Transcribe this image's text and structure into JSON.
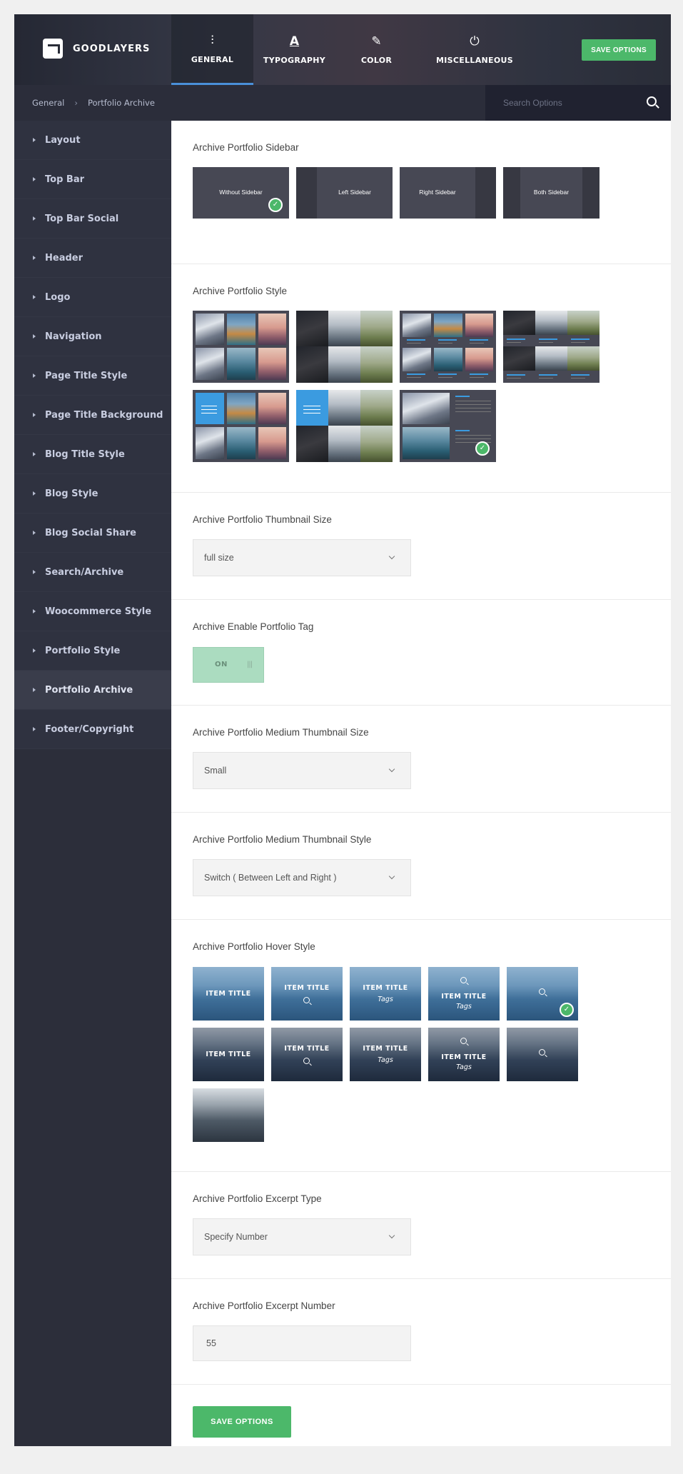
{
  "brand": {
    "name": "GOODLAYERS"
  },
  "tabs": [
    {
      "label": "GENERAL",
      "icon": "sliders-icon"
    },
    {
      "label": "TYPOGRAPHY",
      "icon": "font-icon"
    },
    {
      "label": "COLOR",
      "icon": "palette-icon"
    },
    {
      "label": "MISCELLANEOUS",
      "icon": "plug-icon"
    }
  ],
  "header": {
    "save_label": "SAVE OPTIONS"
  },
  "breadcrumb": {
    "parent": "General",
    "separator": "›",
    "current": "Portfolio Archive"
  },
  "search": {
    "placeholder": "Search Options"
  },
  "sidebar": {
    "items": [
      {
        "label": "Layout"
      },
      {
        "label": "Top Bar"
      },
      {
        "label": "Top Bar Social"
      },
      {
        "label": "Header"
      },
      {
        "label": "Logo"
      },
      {
        "label": "Navigation"
      },
      {
        "label": "Page Title Style"
      },
      {
        "label": "Page Title Background"
      },
      {
        "label": "Blog Title Style"
      },
      {
        "label": "Blog Style"
      },
      {
        "label": "Blog Social Share"
      },
      {
        "label": "Search/Archive"
      },
      {
        "label": "Woocommerce Style"
      },
      {
        "label": "Portfolio Style"
      },
      {
        "label": "Portfolio Archive"
      },
      {
        "label": "Footer/Copyright"
      }
    ],
    "active_item": "Portfolio Archive"
  },
  "sections": {
    "sidebar_layout": {
      "title": "Archive Portfolio Sidebar",
      "options": [
        {
          "label": "Without Sidebar",
          "selected": true
        },
        {
          "label": "Left Sidebar",
          "selected": false
        },
        {
          "label": "Right Sidebar",
          "selected": false
        },
        {
          "label": "Both Sidebar",
          "selected": false
        }
      ]
    },
    "portfolio_style": {
      "title": "Archive Portfolio Style",
      "selected_index": 6,
      "option_count": 7
    },
    "thumbnail_size": {
      "title": "Archive Portfolio Thumbnail Size",
      "value": "full size"
    },
    "enable_tag": {
      "title": "Archive Enable Portfolio Tag",
      "value": "ON"
    },
    "medium_thumbnail_size": {
      "title": "Archive Portfolio Medium Thumbnail Size",
      "value": "Small"
    },
    "medium_thumbnail_style": {
      "title": "Archive Portfolio Medium Thumbnail Style",
      "value": "Switch ( Between Left and Right )"
    },
    "hover_style": {
      "title": "Archive Portfolio Hover Style",
      "item_title": "ITEM TITLE",
      "tags": "Tags",
      "selected_index": 4
    },
    "excerpt_type": {
      "title": "Archive Portfolio Excerpt Type",
      "value": "Specify Number"
    },
    "excerpt_number": {
      "title": "Archive Portfolio Excerpt Number",
      "value": "55"
    }
  },
  "footer": {
    "save_label": "SAVE OPTIONS"
  },
  "colors": {
    "accent_green": "#4cb86a",
    "accent_blue": "#3b9be0",
    "sidebar_bg": "#2c2e3a"
  }
}
